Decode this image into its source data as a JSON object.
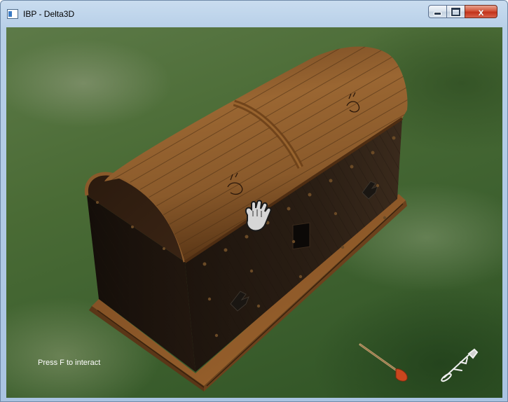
{
  "window": {
    "title": "IBP - Delta3D",
    "close_glyph": "x"
  },
  "hud": {
    "interaction_hint": "Press F to interact"
  },
  "icons": {
    "app": "app-window-icon",
    "cursor": "grab-hand-icon",
    "inventory_left": "shovel-icon",
    "inventory_right": "metal-detector-icon"
  },
  "colors": {
    "wood_light": "#8a5a2b",
    "wood_dark": "#241a12",
    "grass": "#4a6b35",
    "close_red": "#c2331b"
  }
}
